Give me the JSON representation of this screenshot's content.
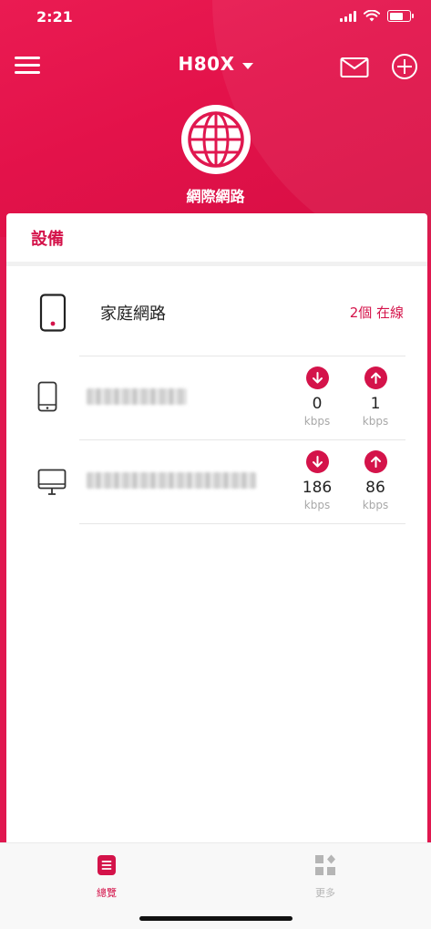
{
  "status_bar": {
    "time": "2:21"
  },
  "header": {
    "device_name": "H80X",
    "icons": [
      "menu-icon",
      "mail-icon",
      "add-icon",
      "caret-down-icon",
      "globe-icon"
    ]
  },
  "internet": {
    "label": "網際網路"
  },
  "devices": {
    "section_title": "設備",
    "network": {
      "name": "家庭網路",
      "online": "2個 在線"
    },
    "clients": [
      {
        "type": "phone",
        "name": "",
        "download": "0",
        "upload": "1",
        "unit": "kbps"
      },
      {
        "type": "desktop",
        "name": "",
        "download": "186",
        "upload": "86",
        "unit": "kbps"
      }
    ]
  },
  "tabbar": {
    "overview": "總覽",
    "more": "更多"
  },
  "colors": {
    "brand": "#e0174f",
    "accent": "#d4134a",
    "inactive": "#b5b5b5"
  }
}
